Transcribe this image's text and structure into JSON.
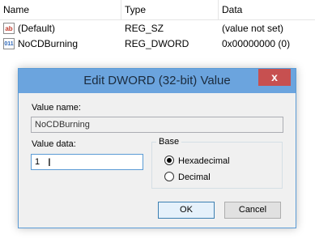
{
  "list": {
    "columns": [
      "Name",
      "Type",
      "Data"
    ],
    "rows": [
      {
        "icon": "ab",
        "name": "(Default)",
        "type": "REG_SZ",
        "data": "(value not set)"
      },
      {
        "icon": "011",
        "name": "NoCDBurning",
        "type": "REG_DWORD",
        "data": "0x00000000 (0)"
      }
    ]
  },
  "dialog": {
    "title": "Edit DWORD (32-bit) Value",
    "close_glyph": "x",
    "value_name_label": "Value name:",
    "value_name": "NoCDBurning",
    "value_data_label": "Value data:",
    "value_data": "1",
    "base_label": "Base",
    "base_options": [
      {
        "label": "Hexadecimal",
        "selected": true
      },
      {
        "label": "Decimal",
        "selected": false
      }
    ],
    "ok_label": "OK",
    "cancel_label": "Cancel"
  },
  "colors": {
    "titlebar": "#6ba4de",
    "close": "#c75050",
    "dialog_bg": "#f0f0f0"
  }
}
